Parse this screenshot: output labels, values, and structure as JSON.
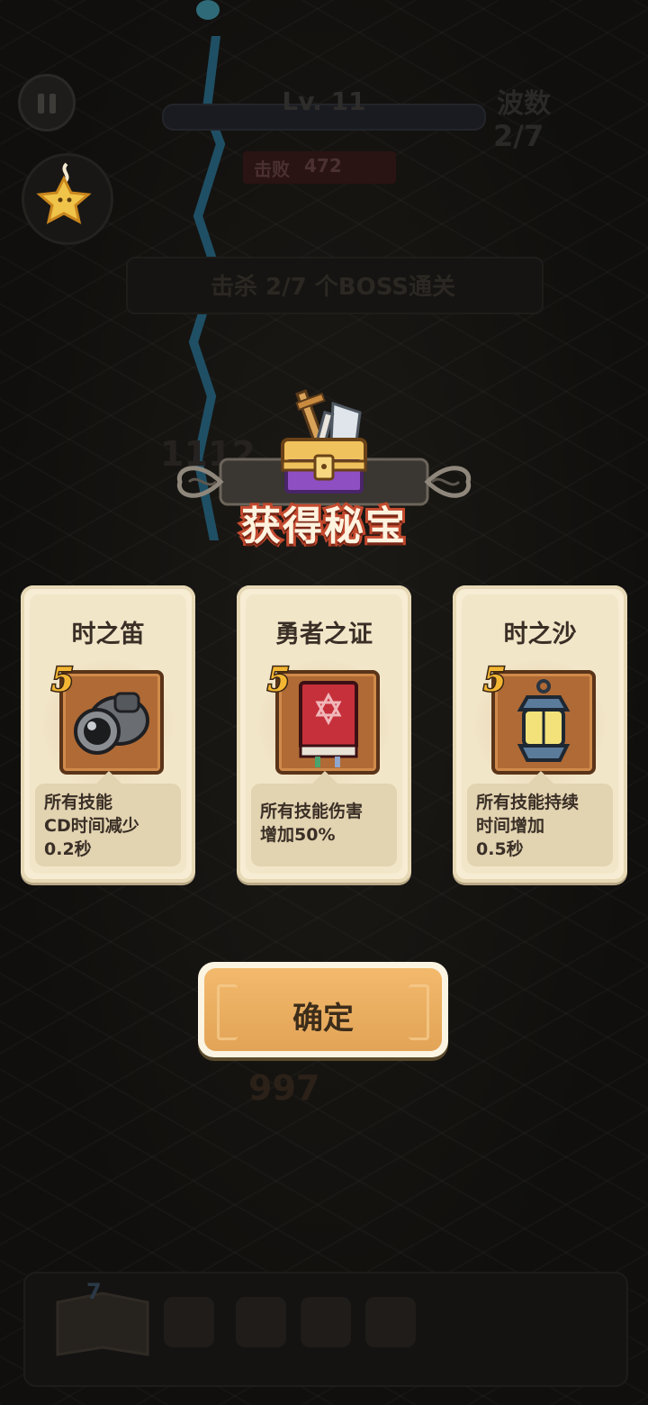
{
  "hud": {
    "level": "Lv. 11",
    "kills_label": "击败",
    "kills_value": "472",
    "wave_label": "波数",
    "wave_value": "2/7",
    "objective": "击杀 2/7 个BOSS通关",
    "damage_numbers": [
      "1112",
      "997"
    ],
    "dock_badge": "7"
  },
  "modal": {
    "title": "获得秘宝",
    "cards": [
      {
        "name": "时之笛",
        "rank": "5",
        "icon": "cannon-icon",
        "description": "所有技能\nCD时间减少\n0.2秒"
      },
      {
        "name": "勇者之证",
        "rank": "5",
        "icon": "red-book-icon",
        "description": "所有技能伤害\n增加50%"
      },
      {
        "name": "时之沙",
        "rank": "5",
        "icon": "lantern-icon",
        "description": "所有技能持续\n时间增加\n0.5秒"
      }
    ],
    "confirm_label": "确定"
  },
  "colors": {
    "card_bg": "#f7edd4",
    "desc_bg": "#e2d3b1",
    "title_stroke": "#c3492e",
    "confirm_bg": "#eeae61",
    "rank_color": "#f3b633"
  }
}
